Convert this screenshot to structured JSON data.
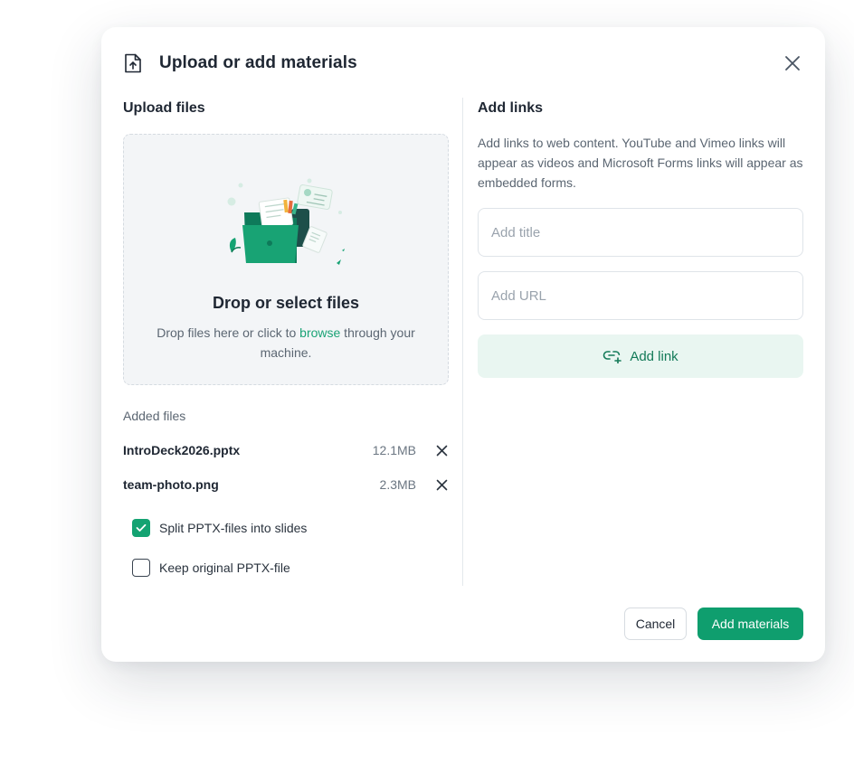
{
  "dialog": {
    "title": "Upload or add materials",
    "header_icon": "file-upload-icon",
    "close_icon": "close-icon"
  },
  "upload": {
    "section_title": "Upload files",
    "dropzone_title": "Drop or select files",
    "dropzone_text_before": "Drop files here or click to ",
    "dropzone_link": "browse",
    "dropzone_text_after": " through your machine.",
    "illustration": "folder-files-illustration",
    "added_files_label": "Added files",
    "files": [
      {
        "name": "IntroDeck2026.pptx",
        "size": "12.1MB"
      },
      {
        "name": "team-photo.png",
        "size": "2.3MB"
      }
    ],
    "options": [
      {
        "label": "Split PPTX-files into slides",
        "checked": true
      },
      {
        "label": "Keep original PPTX-file",
        "checked": false
      }
    ]
  },
  "links": {
    "section_title": "Add links",
    "description": "Add links to web content. YouTube and Vimeo links will appear as videos and Microsoft Forms links will appear as embedded forms.",
    "title_placeholder": "Add title",
    "url_placeholder": "Add URL",
    "add_link_label": "Add link",
    "add_link_icon": "add-link-icon"
  },
  "footer": {
    "cancel_label": "Cancel",
    "submit_label": "Add materials"
  },
  "colors": {
    "accent": "#0f9e6e",
    "accent_light": "#e9f6f1",
    "link_text": "#1aa376"
  }
}
